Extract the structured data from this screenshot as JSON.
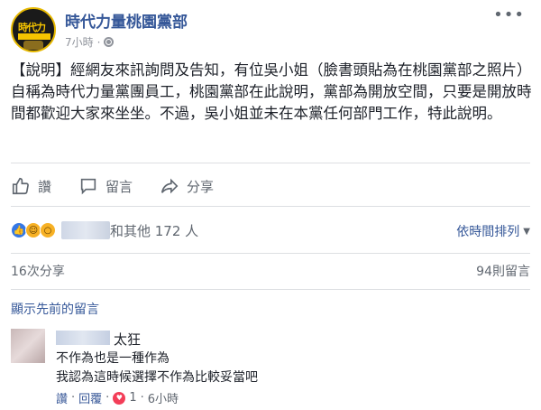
{
  "post": {
    "page_name": "時代力量桃園黨部",
    "time": "7小時",
    "separator": "·",
    "text": "【說明】經網友來訊詢問及告知，有位吳小姐（臉書頭貼為在桃園黨部之照片）自稱為時代力量黨團員工，桃園黨部在此說明，黨部為開放空間，只要是開放時間都歡迎大家來坐坐。不過，吳小姐並未在本黨任何部門工作，特此說明。"
  },
  "logo": {
    "text": "時代力"
  },
  "actions": {
    "like_label": "讚",
    "comment_label": "留言",
    "share_label": "分享"
  },
  "reactions": {
    "others_text": "和其他 172 人",
    "sort_label": "依時間排列",
    "icons": [
      "like-icon",
      "haha-icon",
      "wow-icon"
    ]
  },
  "stats": {
    "shares": "16次分享",
    "comments": "94則留言"
  },
  "previous_comments_label": "顯示先前的留言",
  "comment": {
    "tag": "太狂",
    "line1": "不作為也是一種作為",
    "line2": "我認為這時候選擇不作為比較妥當吧",
    "like": "讚",
    "reply": "回覆",
    "dot": "·",
    "reaction_count": "1",
    "time": "6小時"
  },
  "colors": {
    "link": "#365899",
    "meta": "#90949c",
    "like_blue": "#3578e5",
    "heart_red": "#f33e58",
    "logo_yellow": "#f5c400"
  }
}
